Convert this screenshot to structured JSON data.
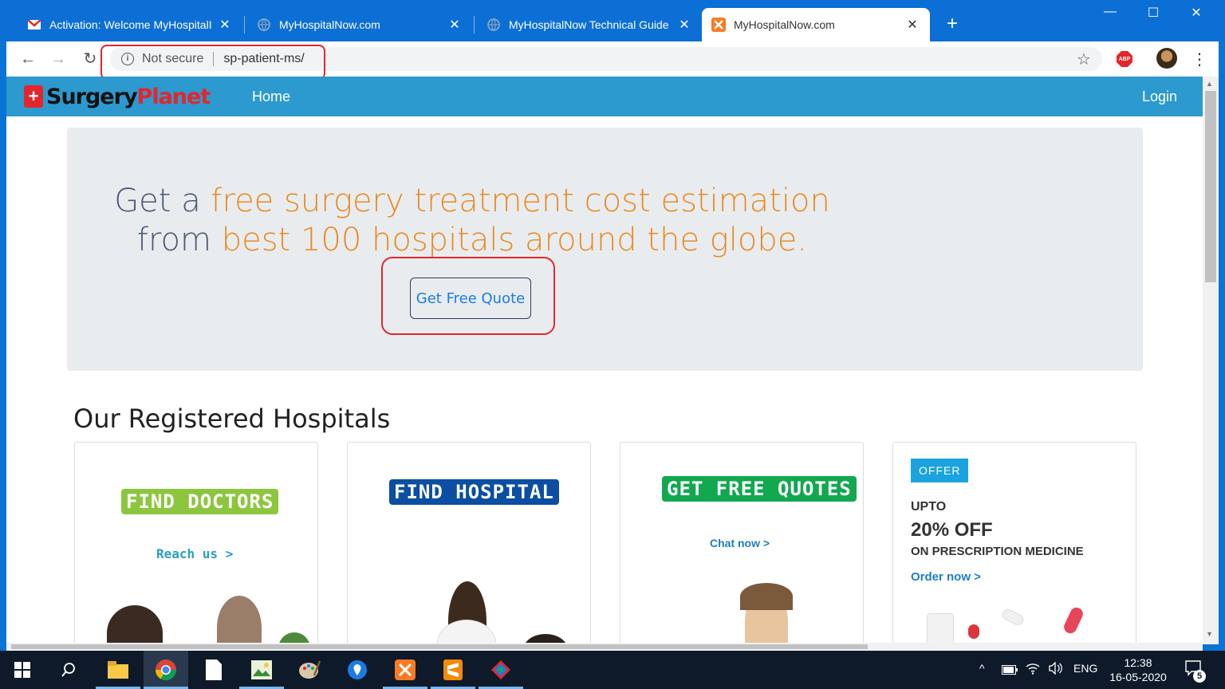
{
  "browser": {
    "tabs": [
      {
        "title": "Activation: Welcome MyHospitalI",
        "favicon": "gmail-icon"
      },
      {
        "title": "MyHospitalNow.com",
        "favicon": "globe-icon"
      },
      {
        "title": "MyHospitalNow Technical Guide",
        "favicon": "globe-icon"
      },
      {
        "title": "MyHospitalNow.com",
        "favicon": "xampp-icon"
      }
    ],
    "new_tab": "+",
    "security_label": "Not secure",
    "url": "sp-patient-ms/"
  },
  "site": {
    "logo_word1": "Surgery",
    "logo_word2": "Planet",
    "nav_home": "Home",
    "nav_login": "Login"
  },
  "hero": {
    "part1": "Get a ",
    "part2": "free surgery treatment cost estimation",
    "part3": " from ",
    "part4": "best 100 hospitals around the globe.",
    "button": "Get Free Quote"
  },
  "hospitals": {
    "title": "Our Registered Hospitals",
    "cards": [
      {
        "badge": "FIND DOCTORS",
        "link": "Reach us >"
      },
      {
        "badge": "FIND HOSPITAL"
      },
      {
        "badge": "GET FREE QUOTES",
        "link": "Chat now >"
      },
      {
        "offer": "OFFER",
        "upto": "UPTO",
        "percent": "20% OFF",
        "desc": "ON PRESCRIPTION MEDICINE",
        "link": "Order now >"
      }
    ]
  },
  "taskbar": {
    "lang": "ENG",
    "time": "12:38",
    "date": "16-05-2020",
    "notifications": "5"
  },
  "colors": {
    "browser_blue": "#0c6fd6",
    "navbar": "#2c99cf",
    "accent_orange": "#e98b23",
    "annotation_red": "#e3262c"
  }
}
